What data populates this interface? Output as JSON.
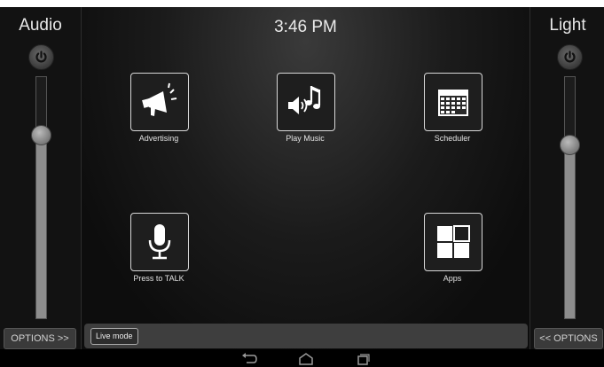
{
  "clock": "3:46 PM",
  "audio": {
    "title": "Audio",
    "options_label": "OPTIONS >>",
    "level": 0.76
  },
  "light": {
    "title": "Light",
    "options_label": "<< OPTIONS",
    "level": 0.72
  },
  "tiles": {
    "advertising": "Advertising",
    "play_music": "Play Music",
    "scheduler": "Scheduler",
    "press_to_talk": "Press to TALK",
    "apps": "Apps"
  },
  "live_mode_label": "Live mode",
  "icons": {
    "power": "power-icon",
    "advertising": "megaphone-icon",
    "play_music": "music-speaker-icon",
    "scheduler": "calendar-icon",
    "press_to_talk": "microphone-icon",
    "apps": "app-grid-icon",
    "back": "back-icon",
    "home": "home-icon",
    "recents": "recents-icon"
  },
  "colors": {
    "background": "#0b0b0b",
    "panel": "#121212",
    "slider_fill": "#8d8d8d",
    "bar": "#3e3e3e"
  }
}
